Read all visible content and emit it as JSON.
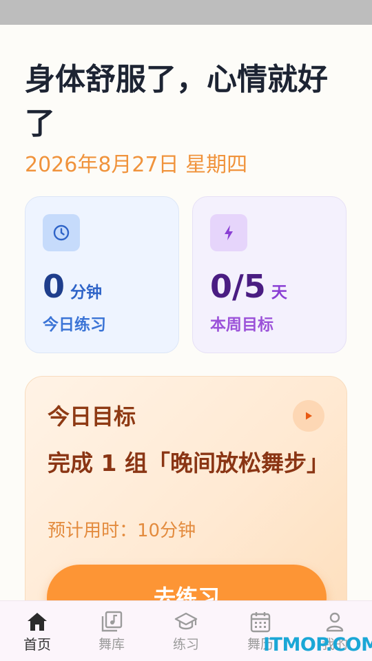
{
  "headline": "身体舒服了，心情就好了",
  "date": "2026年8月27日 星期四",
  "stats": [
    {
      "icon": "clock-icon",
      "value": "0",
      "unit": "分钟",
      "label": "今日练习",
      "accent": "#3B74D6"
    },
    {
      "icon": "lightning-icon",
      "value": "0/5",
      "unit": "天",
      "label": "本周目标",
      "accent": "#9B52D9"
    }
  ],
  "goal": {
    "title": "今日目标",
    "description": "完成 1 组「晚间放松舞步」",
    "estimated_time": "预计用时：10分钟",
    "start_label": "去练习",
    "accent": "#FD9535"
  },
  "nav": [
    {
      "label": "首页",
      "icon": "home-icon",
      "active": true
    },
    {
      "label": "舞库",
      "icon": "music-library-icon",
      "active": false
    },
    {
      "label": "练习",
      "icon": "graduation-cap-icon",
      "active": false
    },
    {
      "label": "舞历",
      "icon": "calendar-icon",
      "active": false
    },
    {
      "label": "我的",
      "icon": "person-icon",
      "active": false
    }
  ],
  "watermark": "ITMOP.COM"
}
